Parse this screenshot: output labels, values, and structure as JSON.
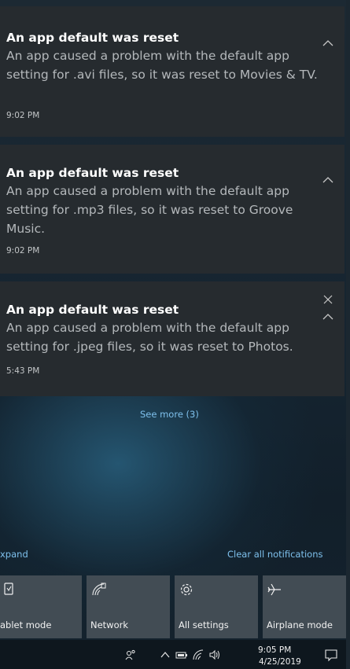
{
  "notifications": [
    {
      "title": "An app default was reset",
      "body": "An app caused a problem with the default app setting for .avi files, so it was reset to Movies & TV.",
      "time": "9:02 PM"
    },
    {
      "title": "An app default was reset",
      "body": "An app caused a problem with the default app setting for .mp3 files, so it was reset to Groove Music.",
      "time": "9:02 PM"
    },
    {
      "title": "An app default was reset",
      "body": "An app caused a problem with the default app setting for .jpeg files, so it was reset to Photos.",
      "time": "5:43 PM"
    }
  ],
  "see_more": "See more (3)",
  "actions": {
    "expand": "xpand",
    "clear_all": "Clear all notifications"
  },
  "quick_actions": [
    {
      "label": "ablet mode",
      "icon": "tablet-mode-icon"
    },
    {
      "label": "Network",
      "icon": "network-icon"
    },
    {
      "label": "All settings",
      "icon": "gear-icon"
    },
    {
      "label": "Airplane mode",
      "icon": "airplane-icon"
    }
  ],
  "taskbar": {
    "time": "9:05 PM",
    "date": "4/25/2019"
  },
  "colors": {
    "card_bg": "#262b2f",
    "tile_bg": "#424c54",
    "link": "#7ec0ec",
    "taskbar_bg": "#0e171e"
  }
}
